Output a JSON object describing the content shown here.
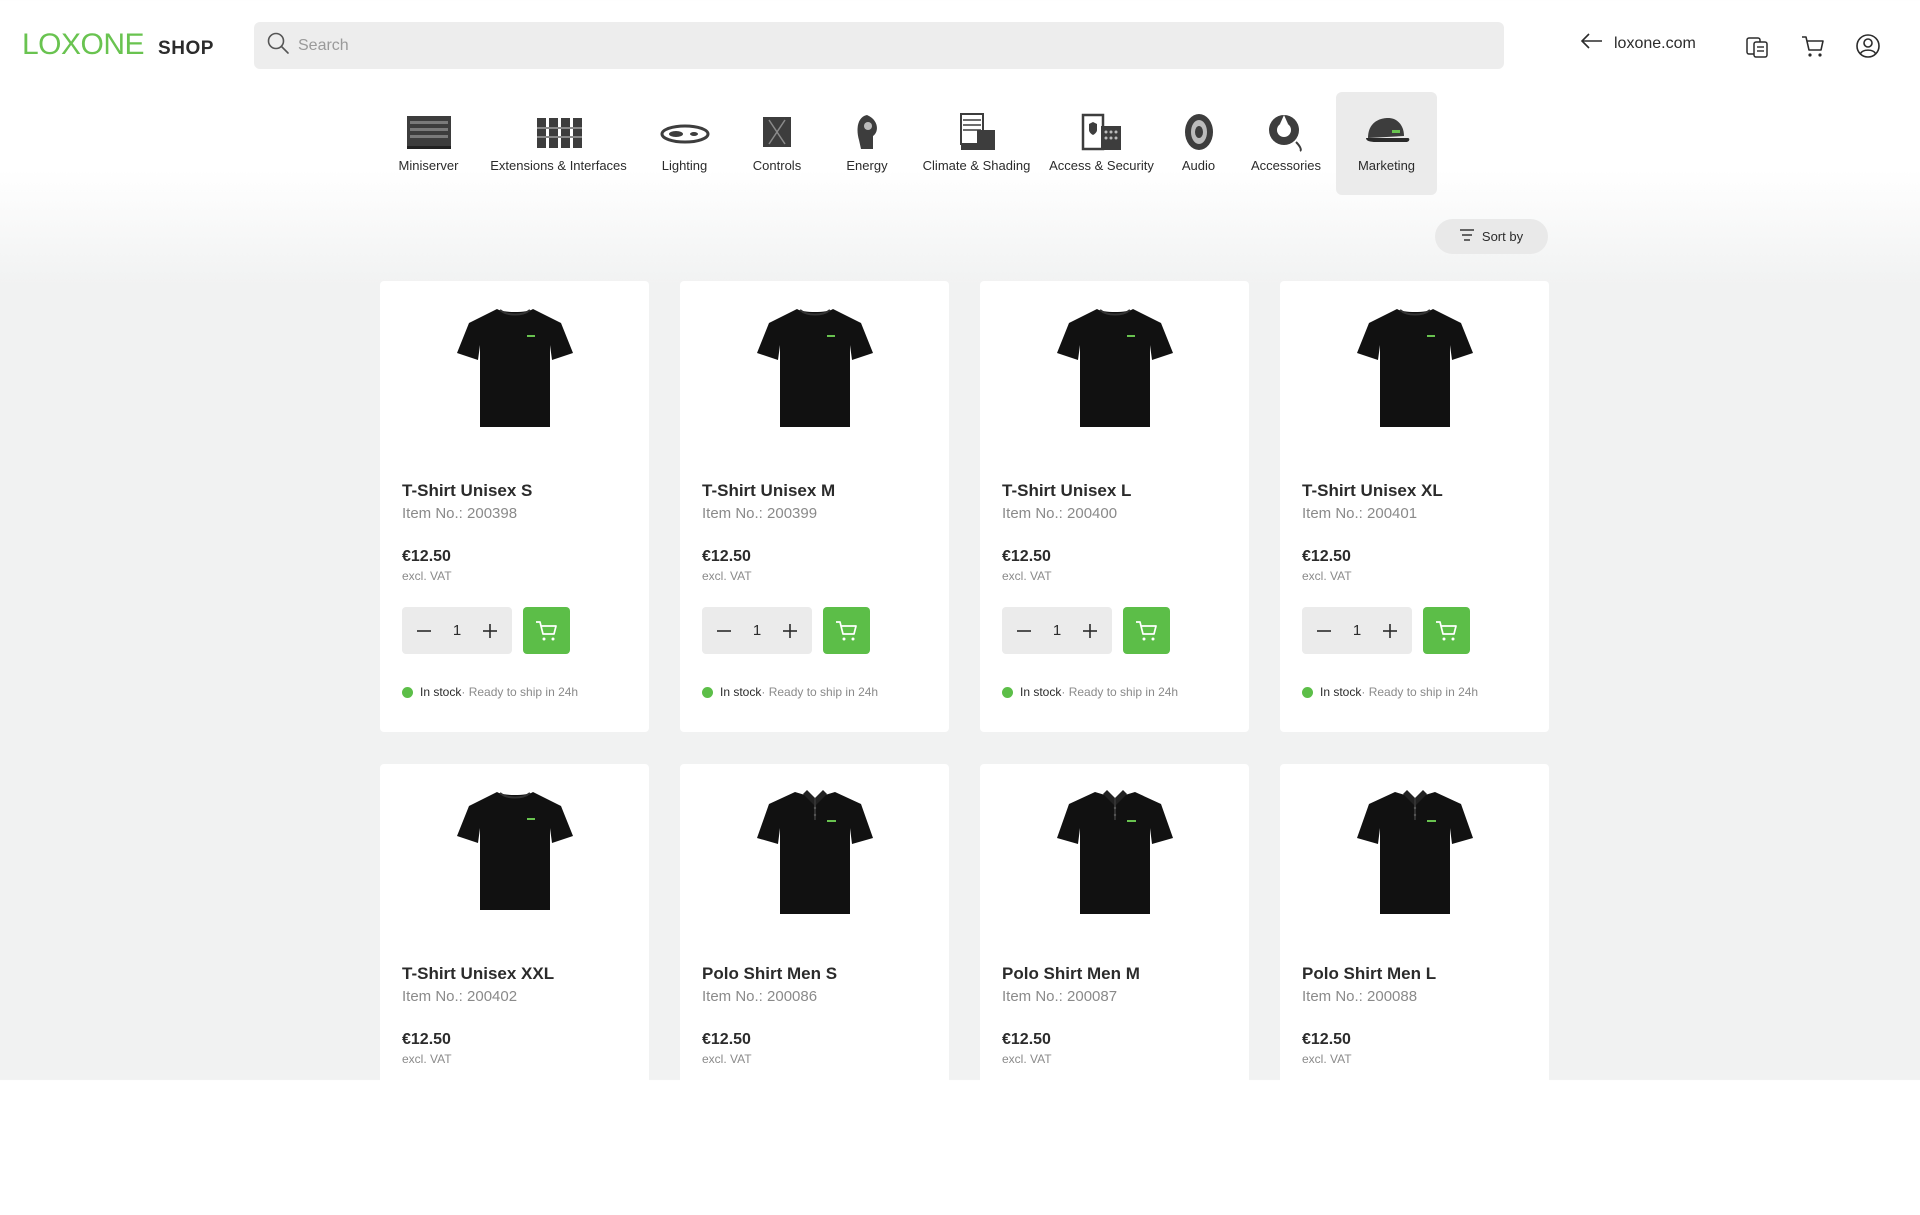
{
  "header": {
    "brand": "LOXONE",
    "shop": "SHOP",
    "search_placeholder": "Search",
    "back_link": "loxone.com",
    "icons": [
      "compare-icon",
      "cart-icon",
      "account-icon"
    ]
  },
  "categories": [
    {
      "label": "Miniserver",
      "icon": "miniserver-icon",
      "active": false
    },
    {
      "label": "Extensions & Interfaces",
      "icon": "extensions-icon",
      "active": false
    },
    {
      "label": "Lighting",
      "icon": "lighting-icon",
      "active": false
    },
    {
      "label": "Controls",
      "icon": "controls-icon",
      "active": false
    },
    {
      "label": "Energy",
      "icon": "energy-icon",
      "active": false
    },
    {
      "label": "Climate & Shading",
      "icon": "climate-icon",
      "active": false
    },
    {
      "label": "Access & Security",
      "icon": "access-icon",
      "active": false
    },
    {
      "label": "Audio",
      "icon": "audio-icon",
      "active": false
    },
    {
      "label": "Accessories",
      "icon": "accessories-icon",
      "active": false
    },
    {
      "label": "Marketing",
      "icon": "cap-icon",
      "active": true
    }
  ],
  "sort": {
    "label": "Sort by"
  },
  "colors": {
    "brand": "#69c350",
    "add_to_cart": "#5cbe48",
    "in_stock": "#5cbe48"
  },
  "products": [
    {
      "title": "T-Shirt Unisex S",
      "item_no": "Item No.: 200398",
      "price": "€12.50",
      "vat": "excl. VAT",
      "qty": "1",
      "stock": "In stock",
      "ship": " · Ready to ship in 24h",
      "kind": "tshirt"
    },
    {
      "title": "T-Shirt Unisex M",
      "item_no": "Item No.: 200399",
      "price": "€12.50",
      "vat": "excl. VAT",
      "qty": "1",
      "stock": "In stock",
      "ship": " · Ready to ship in 24h",
      "kind": "tshirt"
    },
    {
      "title": "T-Shirt Unisex L",
      "item_no": "Item No.: 200400",
      "price": "€12.50",
      "vat": "excl. VAT",
      "qty": "1",
      "stock": "In stock",
      "ship": " · Ready to ship in 24h",
      "kind": "tshirt"
    },
    {
      "title": "T-Shirt Unisex XL",
      "item_no": "Item No.: 200401",
      "price": "€12.50",
      "vat": "excl. VAT",
      "qty": "1",
      "stock": "In stock",
      "ship": " · Ready to ship in 24h",
      "kind": "tshirt"
    },
    {
      "title": "T-Shirt Unisex XXL",
      "item_no": "Item No.: 200402",
      "price": "€12.50",
      "vat": "excl. VAT",
      "kind": "tshirt"
    },
    {
      "title": "Polo Shirt Men S",
      "item_no": "Item No.: 200086",
      "price": "€12.50",
      "vat": "excl. VAT",
      "kind": "polo"
    },
    {
      "title": "Polo Shirt Men M",
      "item_no": "Item No.: 200087",
      "price": "€12.50",
      "vat": "excl. VAT",
      "kind": "polo"
    },
    {
      "title": "Polo Shirt Men L",
      "item_no": "Item No.: 200088",
      "price": "€12.50",
      "vat": "excl. VAT",
      "kind": "polo"
    }
  ]
}
